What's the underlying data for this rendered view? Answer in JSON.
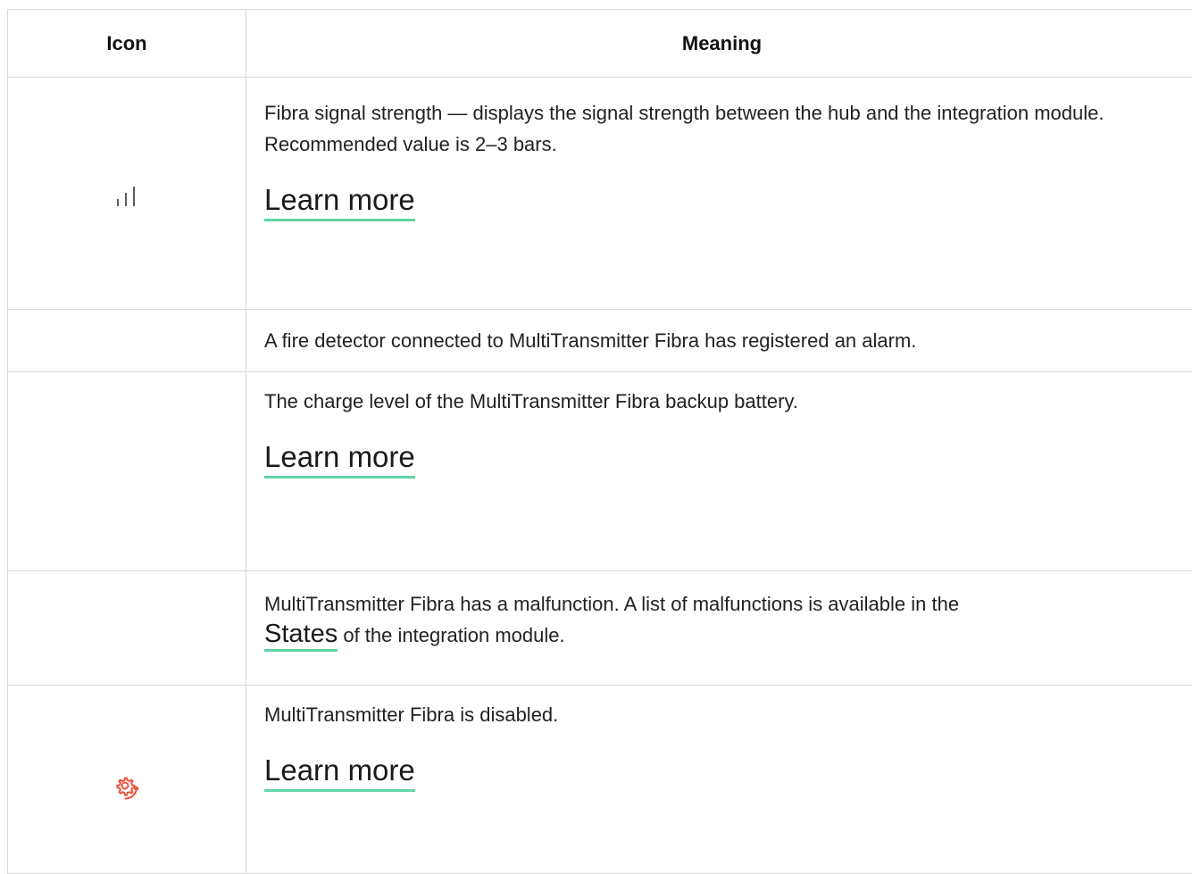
{
  "table": {
    "headers": {
      "icon": "Icon",
      "meaning": "Meaning"
    },
    "rows": [
      {
        "icon": "signal-strength-icon",
        "text": "Fibra signal strength — displays the signal strength between the hub and the integration module. Recommended value is 2–3 bars.",
        "link": "Learn more"
      },
      {
        "icon": "",
        "text": "A fire detector connected to MultiTransmitter Fibra has registered an alarm."
      },
      {
        "icon": "",
        "text": "The charge level of the MultiTransmitter Fibra backup battery.",
        "link": "Learn more"
      },
      {
        "icon": "",
        "text_before": "MultiTransmitter Fibra has a malfunction. A list of malfunctions is available in the",
        "link": "States",
        "text_after": " of the integration module."
      },
      {
        "icon": "gear-disabled-icon",
        "text": "MultiTransmitter Fibra is disabled.",
        "link": "Learn more"
      }
    ]
  },
  "colors": {
    "link_underline": "#5fd6a4",
    "disabled_icon": "#e8553f",
    "border": "#d9d9d9"
  }
}
